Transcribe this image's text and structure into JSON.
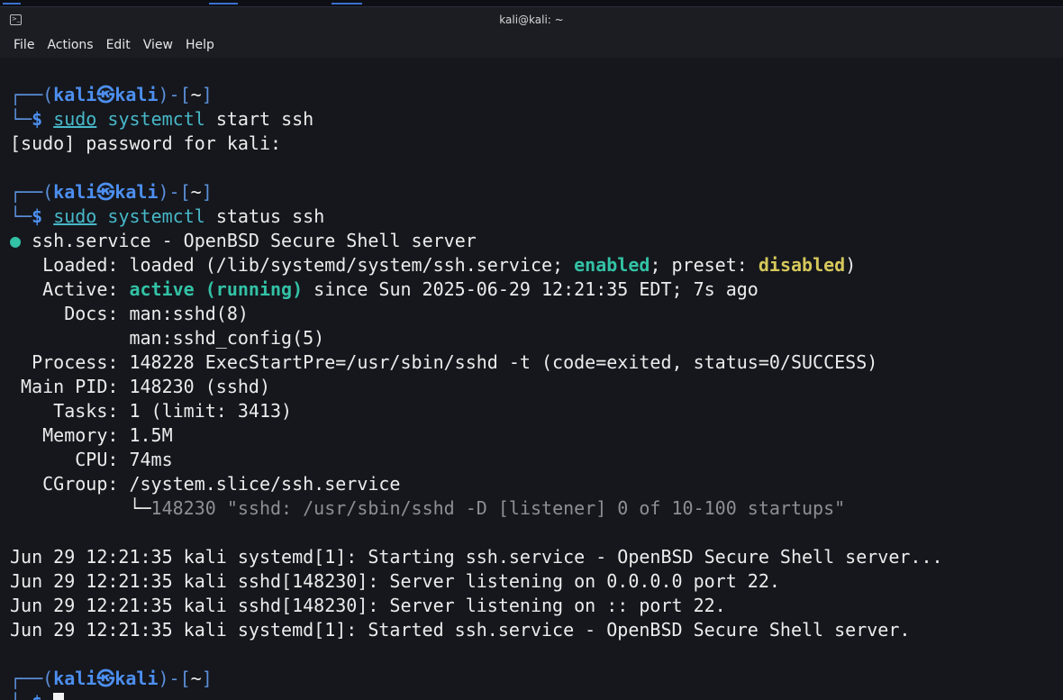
{
  "window": {
    "title": "kali@kali: ~"
  },
  "menu": [
    "File",
    "Actions",
    "Edit",
    "View",
    "Help"
  ],
  "prompt": {
    "user": "kali",
    "sep": "㉿",
    "host": "kali",
    "dir": "~",
    "symbol": "$"
  },
  "commands": {
    "first": {
      "sudo": "sudo",
      "prog": "systemctl",
      "args": " start ssh"
    },
    "second": {
      "sudo": "sudo",
      "prog": "systemctl",
      "args": " status ssh"
    }
  },
  "sudo_prompt": "[sudo] password for kali:",
  "status": {
    "title": "ssh.service - OpenBSD Secure Shell server",
    "loaded_label": "   Loaded: ",
    "loaded_pre": "loaded (/lib/systemd/system/ssh.service; ",
    "loaded_enabled": "enabled",
    "loaded_mid": "; preset: ",
    "loaded_preset": "disabled",
    "loaded_post": ")",
    "active_label": "   Active: ",
    "active_state": "active (running)",
    "active_since": " since Sun 2025-06-29 12:21:35 EDT; 7s ago",
    "docs_label": "     Docs: ",
    "docs_1": "man:sshd(8)",
    "docs_2": "           man:sshd_config(5)",
    "process": "  Process: 148228 ExecStartPre=/usr/sbin/sshd -t (code=exited, status=0/SUCCESS)",
    "main_pid": " Main PID: 148230 (sshd)",
    "tasks": "    Tasks: 1 (limit: 3413)",
    "memory": "   Memory: 1.5M",
    "cpu": "      CPU: 74ms",
    "cgroup": "   CGroup: /system.slice/ssh.service",
    "cgroup_child_prefix": "           └─",
    "cgroup_child": "148230 \"sshd: /usr/sbin/sshd -D [listener] 0 of 10-100 startups\""
  },
  "log": [
    "Jun 29 12:21:35 kali systemd[1]: Starting ssh.service - OpenBSD Secure Shell server...",
    "Jun 29 12:21:35 kali sshd[148230]: Server listening on 0.0.0.0 port 22.",
    "Jun 29 12:21:35 kali sshd[148230]: Server listening on :: port 22.",
    "Jun 29 12:21:35 kali systemd[1]: Started ssh.service - OpenBSD Secure Shell server."
  ]
}
